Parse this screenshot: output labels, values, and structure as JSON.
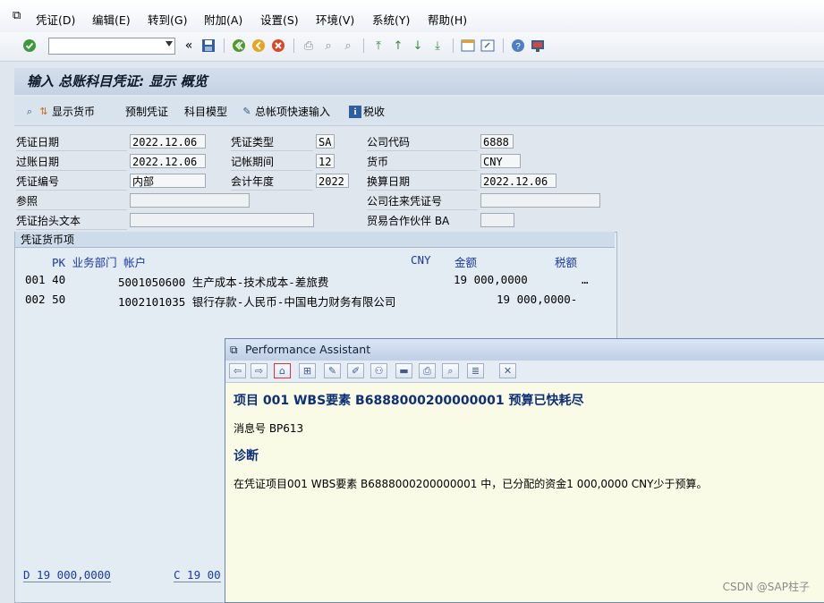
{
  "menubar": {
    "items": [
      "凭证(D)",
      "编辑(E)",
      "转到(G)",
      "附加(A)",
      "设置(S)",
      "环境(V)",
      "系统(Y)",
      "帮助(H)"
    ]
  },
  "toolbar": {
    "command_field_value": "",
    "icons": [
      "enter-icon",
      "save-icon",
      "back-icon",
      "exit-icon",
      "cancel-icon",
      "print-icon",
      "find-icon",
      "find-next-icon",
      "first-page-icon",
      "previous-page-icon",
      "next-page-icon",
      "last-page-icon",
      "create-session-icon",
      "shortcut-icon",
      "help-icon",
      "customize-layout-icon"
    ]
  },
  "title": "输入 总账科目凭证: 显示 概览",
  "app_toolbar": {
    "btn1": "显示货币",
    "btn2": "预制凭证",
    "btn3": "科目模型",
    "btn4": "总帐项快速输入",
    "btn5": "税收"
  },
  "form": {
    "doc_date_label": "凭证日期",
    "doc_date": "2022.12.06",
    "post_date_label": "过账日期",
    "post_date": "2022.12.06",
    "doc_no_label": "凭证编号",
    "doc_no": "内部",
    "ref_label": "参照",
    "ref": "",
    "header_text_label": "凭证抬头文本",
    "header_text": "",
    "doc_type_label": "凭证类型",
    "doc_type": "SA",
    "period_label": "记帐期间",
    "period": "12",
    "fiscal_year_label": "会计年度",
    "fiscal_year": "2022",
    "company_code_label": "公司代码",
    "company_code": "6888",
    "currency_label": "货币",
    "currency": "CNY",
    "translation_date_label": "换算日期",
    "translation_date": "2022.12.06",
    "intercompany_label": "公司往来凭证号",
    "intercompany": "",
    "trading_partner_label": "贸易合作伙伴 BA",
    "trading_partner": ""
  },
  "items_group": {
    "title": "凭证货币项",
    "col_pk_bus_acct": "PK 业务部门 帐户",
    "col_cny": "CNY",
    "col_amount": "金额",
    "col_tax": "税额",
    "rows": [
      {
        "line": "001 40",
        "account": "5001050600 生产成本-技术成本-差旅费",
        "amount": "19 000,0000",
        "tax": "…"
      },
      {
        "line": "002 50",
        "account": "1002101035 银行存款-人民币-中国电力财务有限公司",
        "amount": "19 000,0000-",
        "tax": ""
      }
    ],
    "debit_total": "D 19 000,0000",
    "credit_total": "C 19 00"
  },
  "performance_assistant": {
    "title": "Performance Assistant",
    "heading": "项目 001 WBS要素 B6888000200000001 预算已快耗尽",
    "message_no": "消息号 BP613",
    "diagnosis_heading": "诊断",
    "diagnosis_text": "在凭证项目001 WBS要素 B6888000200000001 中，已分配的资金1 000,0000 CNY少于预算。"
  },
  "watermark": "CSDN @SAP柱子"
}
